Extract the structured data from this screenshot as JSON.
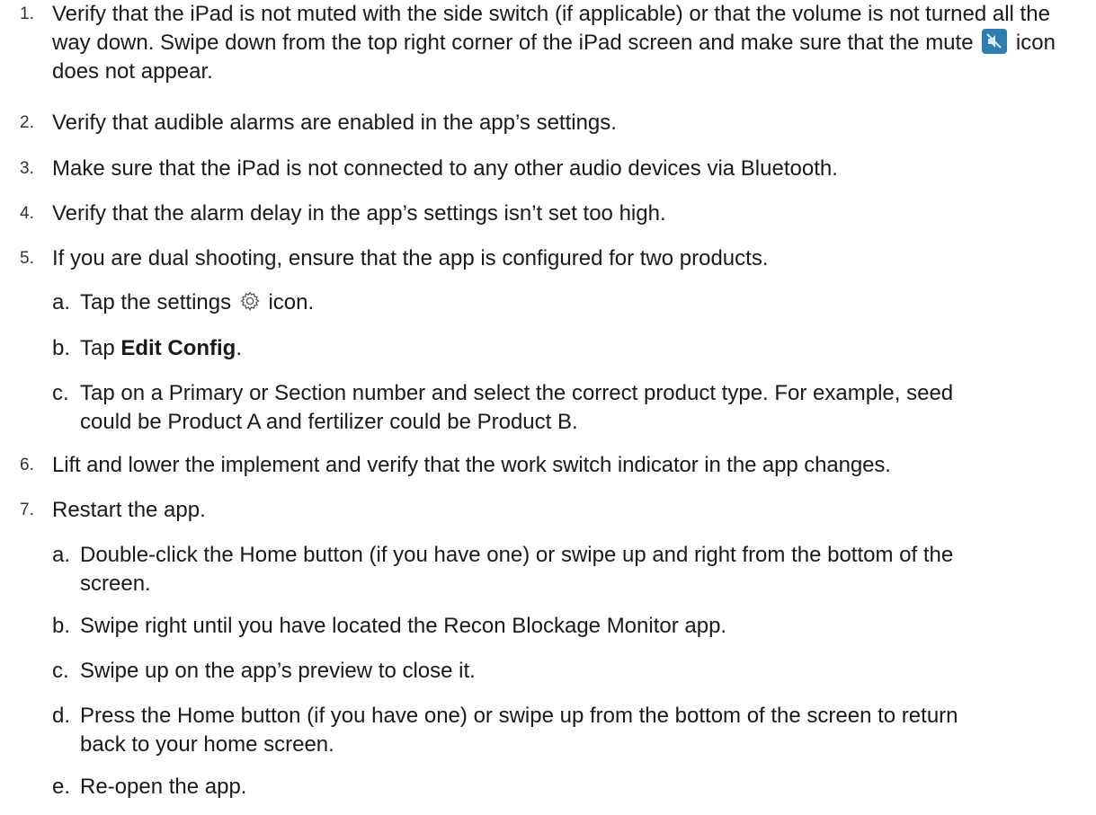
{
  "steps": [
    {
      "num": "1.",
      "text_a": "Verify that the iPad is not muted with the side switch (if applicable) or that the volume is not turned all the way down. Swipe down from the top right corner of the iPad screen and make sure that the mute",
      "text_b": "icon does not appear.",
      "icon": "mute-speaker-icon",
      "icon_color": "#2e7fb0"
    },
    {
      "num": "2.",
      "text": "Verify that audible alarms are enabled in the app’s settings."
    },
    {
      "num": "3.",
      "text": "Make sure that the iPad is not connected to any other audio devices via Bluetooth."
    },
    {
      "num": "4.",
      "text": "Verify that the alarm delay in the app’s settings isn’t set too high."
    },
    {
      "num": "5.",
      "text": "If you are dual shooting, ensure that the app is configured for two products.",
      "substeps": [
        {
          "letter": "a.",
          "text_a": "Tap the settings",
          "text_b": "icon.",
          "icon": "gear-icon"
        },
        {
          "letter": "b.",
          "text_a": "Tap",
          "bold": "Edit Config",
          "text_b": "."
        },
        {
          "letter": "c.",
          "text": "Tap on a Primary or Section number and select the correct product type. For example, seed could be Product A and fertilizer could be Product B."
        }
      ]
    },
    {
      "num": "6.",
      "text": "Lift and lower the implement and verify that the work switch indicator in the app changes."
    },
    {
      "num": "7.",
      "text": "Restart the app.",
      "substeps": [
        {
          "letter": "a.",
          "text": "Double-click the Home button (if you have one) or swipe up and right from the bottom of the screen."
        },
        {
          "letter": "b.",
          "text": "Swipe right until you have located the Recon Blockage Monitor app."
        },
        {
          "letter": "c.",
          "text": "Swipe up on the app’s preview to close it."
        },
        {
          "letter": "d.",
          "text": "Press the Home button (if you have one) or swipe up from the bottom of the screen to return back to your home screen."
        },
        {
          "letter": "e.",
          "text": "Re-open the app."
        }
      ]
    }
  ]
}
